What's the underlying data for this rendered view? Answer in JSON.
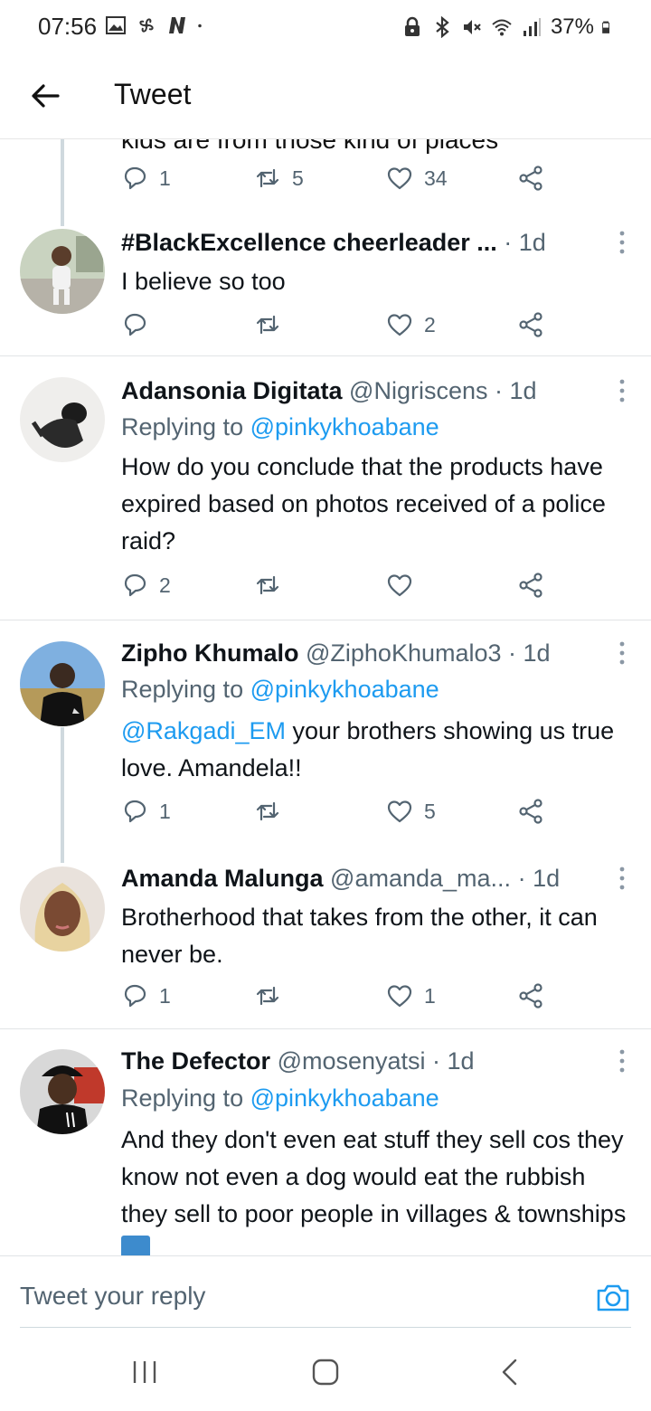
{
  "status_bar": {
    "time": "07:56",
    "battery": "37%",
    "left_icons": [
      "gallery-icon",
      "pinwheel-icon",
      "n-app-icon",
      "dot-icon"
    ],
    "right_icons": [
      "lock-icon",
      "bluetooth-icon",
      "mute-icon",
      "wifi-icon",
      "signal-icon",
      "battery-icon"
    ]
  },
  "header": {
    "title": "Tweet"
  },
  "clipped_tweet": {
    "partial_text": "kids are from those kind of places",
    "reply_count": "1",
    "retweet_count": "5",
    "like_count": "34"
  },
  "tweets": [
    {
      "name": "#BlackExcellence cheerleader ...",
      "handle": "",
      "time": "· 1d",
      "replying_to_label": "",
      "replying_to": "",
      "body_prefix": "",
      "body": "I believe so too",
      "reply_count": "",
      "retweet_count": "",
      "like_count": "2"
    },
    {
      "name": "Adansonia Digitata",
      "handle": "@Nigriscens",
      "time": "· 1d",
      "replying_to_label": "Replying to",
      "replying_to": "@pinkykhoabane",
      "body_prefix": "",
      "body": "How do you conclude that the products have expired based on photos received of a police raid?",
      "reply_count": "2",
      "retweet_count": "",
      "like_count": ""
    },
    {
      "name": "Zipho Khumalo",
      "handle": "@ZiphoKhumalo3",
      "time": "· 1d",
      "replying_to_label": "Replying to",
      "replying_to": "@pinkykhoabane",
      "body_prefix": "@Rakgadi_EM",
      "body": " your brothers showing us true love. Amandela!!",
      "reply_count": "1",
      "retweet_count": "",
      "like_count": "5"
    },
    {
      "name": "Amanda Malunga",
      "handle": "@amanda_ma...",
      "time": "· 1d",
      "replying_to_label": "",
      "replying_to": "",
      "body_prefix": "",
      "body": "Brotherhood that takes from the other, it can never be.",
      "reply_count": "1",
      "retweet_count": "",
      "like_count": "1"
    },
    {
      "name": "The Defector",
      "handle": "@mosenyatsi",
      "time": "· 1d",
      "replying_to_label": "Replying to",
      "replying_to": "@pinkykhoabane",
      "body_prefix": "",
      "body": "And they don't even eat stuff they sell cos they know not even a dog would eat the rubbish they sell to poor people in villages & townships",
      "reply_count": "",
      "retweet_count": "",
      "like_count": ""
    }
  ],
  "composer": {
    "placeholder": "Tweet your reply"
  },
  "colors": {
    "accent": "#1d9bf0",
    "secondary_text": "#536471",
    "thread_line": "#cfd9de"
  }
}
